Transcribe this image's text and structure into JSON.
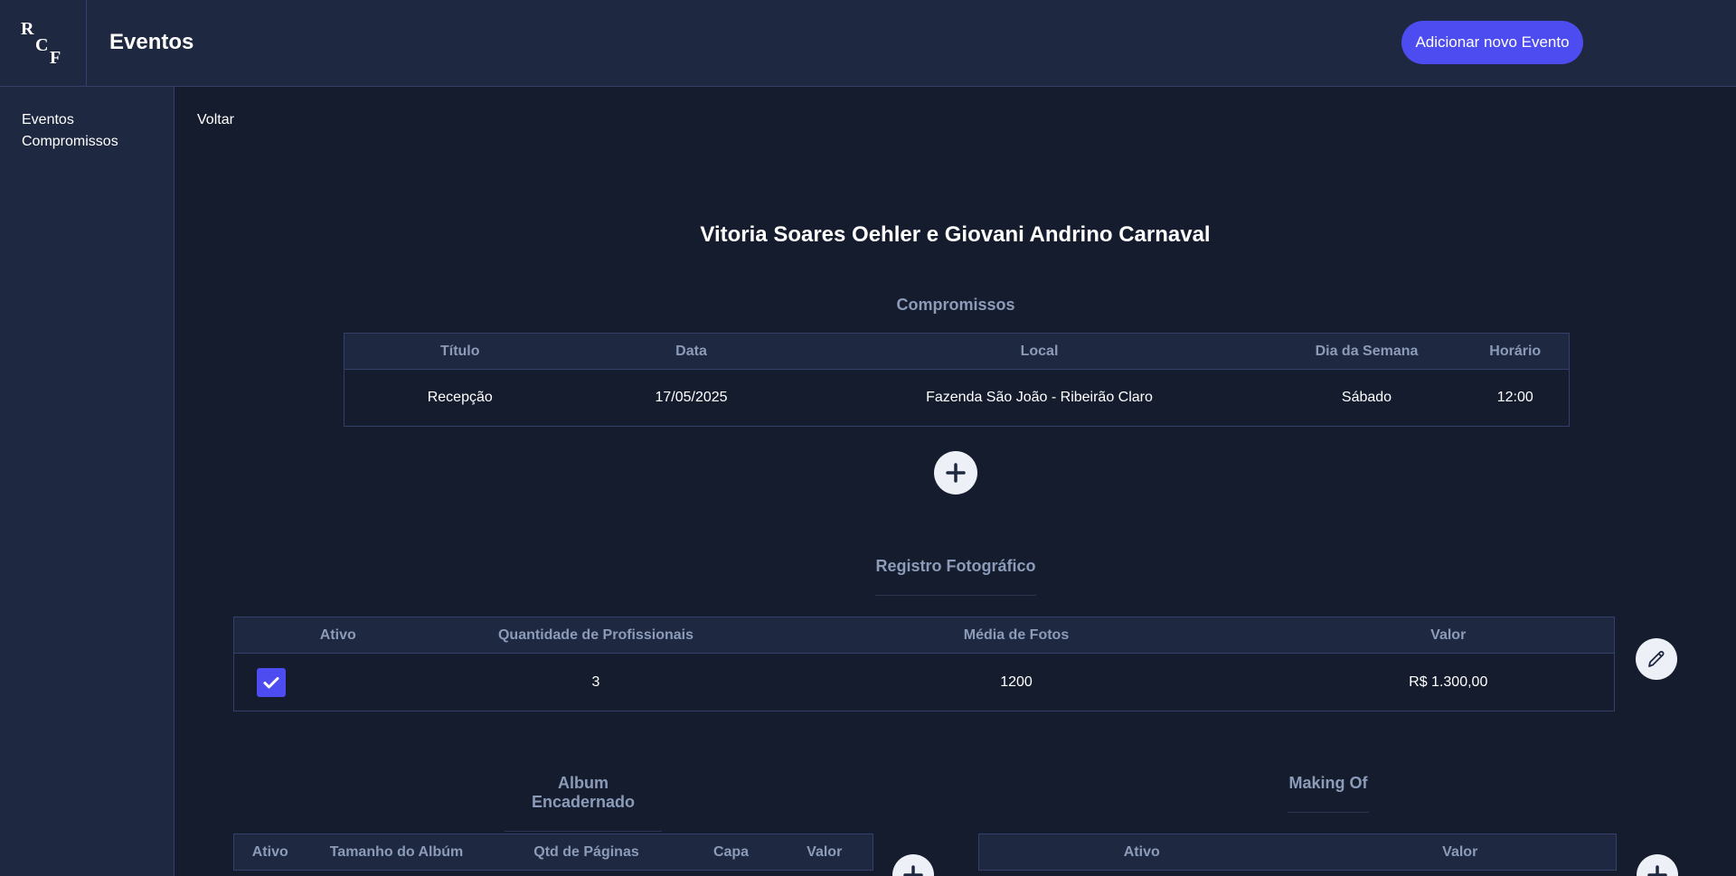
{
  "header": {
    "logo_letters": [
      "R",
      "C",
      "F"
    ],
    "page_title": "Eventos",
    "add_button": "Adicionar novo Evento"
  },
  "sidebar": {
    "items": [
      {
        "label": "Eventos"
      },
      {
        "label": "Compromissos"
      }
    ]
  },
  "back_label": "Voltar",
  "event_title": "Vitoria Soares Oehler e Giovani Andrino Carnaval",
  "compromissos": {
    "title": "Compromissos",
    "columns": [
      "Título",
      "Data",
      "Local",
      "Dia da Semana",
      "Horário"
    ],
    "rows": [
      [
        "Recepção",
        "17/05/2025",
        "Fazenda São João - Ribeirão Claro",
        "Sábado",
        "12:00"
      ]
    ]
  },
  "registro": {
    "title": "Registro Fotográfico",
    "columns": [
      "Ativo",
      "Quantidade de Profissionais",
      "Média de Fotos",
      "Valor"
    ],
    "rows": [
      {
        "ativo": true,
        "quantidade": "3",
        "media": "1200",
        "valor": "R$ 1.300,00"
      }
    ]
  },
  "album": {
    "title": "Album Encadernado",
    "columns": [
      "Ativo",
      "Tamanho do Albúm",
      "Qtd de Páginas",
      "Capa",
      "Valor"
    ]
  },
  "making_of": {
    "title": "Making Of",
    "columns": [
      "Ativo",
      "Valor"
    ]
  },
  "icons": {
    "add": "plus-icon",
    "edit": "pencil-icon",
    "check": "check-icon"
  },
  "colors": {
    "accent": "#4d4cf0",
    "background": "#151c2e",
    "panel": "#1f2841",
    "muted_text": "#8b9bb8"
  }
}
